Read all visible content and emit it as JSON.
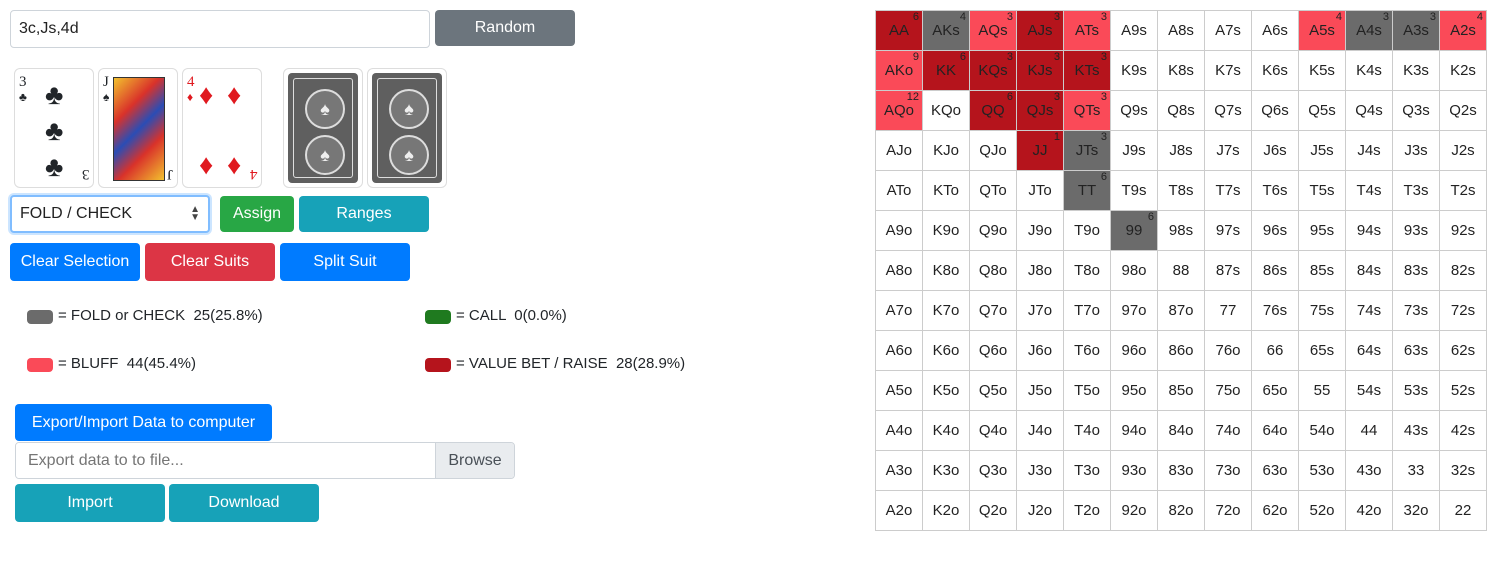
{
  "board_input": {
    "value": "3c,Js,4d"
  },
  "random_button": "Random",
  "cards": [
    {
      "rank": "3",
      "suit": "♣",
      "color": "#000000"
    },
    {
      "rank": "J",
      "suit": "♠",
      "color": "#000000"
    },
    {
      "rank": "4",
      "suit": "♦",
      "color": "#e0191f"
    }
  ],
  "card_back_icon": "spade-emblem",
  "action_select": {
    "value": "FOLD / CHECK"
  },
  "buttons": {
    "assign": "Assign",
    "ranges": "Ranges",
    "clear_selection": "Clear Selection",
    "clear_suits": "Clear Suits",
    "split_suit": "Split Suit",
    "export_import": "Export/Import Data to computer",
    "browse": "Browse",
    "import": "Import",
    "download": "Download"
  },
  "file_input": {
    "placeholder": "Export data to to file..."
  },
  "legend": {
    "fold": {
      "label": "= FOLD or CHECK",
      "stats": "25(25.8%)",
      "color": "#6b6b6b"
    },
    "call": {
      "label": "= CALL",
      "stats": "0(0.0%)",
      "color": "#1f7a1f"
    },
    "bluff": {
      "label": "= BLUFF",
      "stats": "44(45.4%)",
      "color": "#fa4a58"
    },
    "value": {
      "label": "= VALUE BET / RAISE",
      "stats": "28(28.9%)",
      "color": "#b5141c"
    }
  },
  "grid": [
    [
      [
        "AA",
        "value",
        "6"
      ],
      [
        "AKs",
        "fold",
        "4"
      ],
      [
        "AQs",
        "bluff",
        "3"
      ],
      [
        "AJs",
        "value",
        "3"
      ],
      [
        "ATs",
        "bluff",
        "3"
      ],
      [
        "A9s",
        "",
        ""
      ],
      [
        "A8s",
        "",
        ""
      ],
      [
        "A7s",
        "",
        ""
      ],
      [
        "A6s",
        "",
        ""
      ],
      [
        "A5s",
        "bluff",
        "4"
      ],
      [
        "A4s",
        "fold",
        "3"
      ],
      [
        "A3s",
        "fold",
        "3"
      ],
      [
        "A2s",
        "bluff",
        "4"
      ]
    ],
    [
      [
        "AKo",
        "bluff",
        "9"
      ],
      [
        "KK",
        "value",
        "6"
      ],
      [
        "KQs",
        "value",
        "3"
      ],
      [
        "KJs",
        "value",
        "3"
      ],
      [
        "KTs",
        "value",
        "3"
      ],
      [
        "K9s",
        "",
        ""
      ],
      [
        "K8s",
        "",
        ""
      ],
      [
        "K7s",
        "",
        ""
      ],
      [
        "K6s",
        "",
        ""
      ],
      [
        "K5s",
        "",
        ""
      ],
      [
        "K4s",
        "",
        ""
      ],
      [
        "K3s",
        "",
        ""
      ],
      [
        "K2s",
        "",
        ""
      ]
    ],
    [
      [
        "AQo",
        "bluff",
        "12"
      ],
      [
        "KQo",
        "",
        ""
      ],
      [
        "QQ",
        "value",
        "6"
      ],
      [
        "QJs",
        "value",
        "3"
      ],
      [
        "QTs",
        "bluff",
        "3"
      ],
      [
        "Q9s",
        "",
        ""
      ],
      [
        "Q8s",
        "",
        ""
      ],
      [
        "Q7s",
        "",
        ""
      ],
      [
        "Q6s",
        "",
        ""
      ],
      [
        "Q5s",
        "",
        ""
      ],
      [
        "Q4s",
        "",
        ""
      ],
      [
        "Q3s",
        "",
        ""
      ],
      [
        "Q2s",
        "",
        ""
      ]
    ],
    [
      [
        "AJo",
        "",
        ""
      ],
      [
        "KJo",
        "",
        ""
      ],
      [
        "QJo",
        "",
        ""
      ],
      [
        "JJ",
        "value",
        "1"
      ],
      [
        "JTs",
        "fold",
        "3"
      ],
      [
        "J9s",
        "",
        ""
      ],
      [
        "J8s",
        "",
        ""
      ],
      [
        "J7s",
        "",
        ""
      ],
      [
        "J6s",
        "",
        ""
      ],
      [
        "J5s",
        "",
        ""
      ],
      [
        "J4s",
        "",
        ""
      ],
      [
        "J3s",
        "",
        ""
      ],
      [
        "J2s",
        "",
        ""
      ]
    ],
    [
      [
        "ATo",
        "",
        ""
      ],
      [
        "KTo",
        "",
        ""
      ],
      [
        "QTo",
        "",
        ""
      ],
      [
        "JTo",
        "",
        ""
      ],
      [
        "TT",
        "fold",
        "6"
      ],
      [
        "T9s",
        "",
        ""
      ],
      [
        "T8s",
        "",
        ""
      ],
      [
        "T7s",
        "",
        ""
      ],
      [
        "T6s",
        "",
        ""
      ],
      [
        "T5s",
        "",
        ""
      ],
      [
        "T4s",
        "",
        ""
      ],
      [
        "T3s",
        "",
        ""
      ],
      [
        "T2s",
        "",
        ""
      ]
    ],
    [
      [
        "A9o",
        "",
        ""
      ],
      [
        "K9o",
        "",
        ""
      ],
      [
        "Q9o",
        "",
        ""
      ],
      [
        "J9o",
        "",
        ""
      ],
      [
        "T9o",
        "",
        ""
      ],
      [
        "99",
        "fold",
        "6"
      ],
      [
        "98s",
        "",
        ""
      ],
      [
        "97s",
        "",
        ""
      ],
      [
        "96s",
        "",
        ""
      ],
      [
        "95s",
        "",
        ""
      ],
      [
        "94s",
        "",
        ""
      ],
      [
        "93s",
        "",
        ""
      ],
      [
        "92s",
        "",
        ""
      ]
    ],
    [
      [
        "A8o",
        "",
        ""
      ],
      [
        "K8o",
        "",
        ""
      ],
      [
        "Q8o",
        "",
        ""
      ],
      [
        "J8o",
        "",
        ""
      ],
      [
        "T8o",
        "",
        ""
      ],
      [
        "98o",
        "",
        ""
      ],
      [
        "88",
        "",
        ""
      ],
      [
        "87s",
        "",
        ""
      ],
      [
        "86s",
        "",
        ""
      ],
      [
        "85s",
        "",
        ""
      ],
      [
        "84s",
        "",
        ""
      ],
      [
        "83s",
        "",
        ""
      ],
      [
        "82s",
        "",
        ""
      ]
    ],
    [
      [
        "A7o",
        "",
        ""
      ],
      [
        "K7o",
        "",
        ""
      ],
      [
        "Q7o",
        "",
        ""
      ],
      [
        "J7o",
        "",
        ""
      ],
      [
        "T7o",
        "",
        ""
      ],
      [
        "97o",
        "",
        ""
      ],
      [
        "87o",
        "",
        ""
      ],
      [
        "77",
        "",
        ""
      ],
      [
        "76s",
        "",
        ""
      ],
      [
        "75s",
        "",
        ""
      ],
      [
        "74s",
        "",
        ""
      ],
      [
        "73s",
        "",
        ""
      ],
      [
        "72s",
        "",
        ""
      ]
    ],
    [
      [
        "A6o",
        "",
        ""
      ],
      [
        "K6o",
        "",
        ""
      ],
      [
        "Q6o",
        "",
        ""
      ],
      [
        "J6o",
        "",
        ""
      ],
      [
        "T6o",
        "",
        ""
      ],
      [
        "96o",
        "",
        ""
      ],
      [
        "86o",
        "",
        ""
      ],
      [
        "76o",
        "",
        ""
      ],
      [
        "66",
        "",
        ""
      ],
      [
        "65s",
        "",
        ""
      ],
      [
        "64s",
        "",
        ""
      ],
      [
        "63s",
        "",
        ""
      ],
      [
        "62s",
        "",
        ""
      ]
    ],
    [
      [
        "A5o",
        "",
        ""
      ],
      [
        "K5o",
        "",
        ""
      ],
      [
        "Q5o",
        "",
        ""
      ],
      [
        "J5o",
        "",
        ""
      ],
      [
        "T5o",
        "",
        ""
      ],
      [
        "95o",
        "",
        ""
      ],
      [
        "85o",
        "",
        ""
      ],
      [
        "75o",
        "",
        ""
      ],
      [
        "65o",
        "",
        ""
      ],
      [
        "55",
        "",
        ""
      ],
      [
        "54s",
        "",
        ""
      ],
      [
        "53s",
        "",
        ""
      ],
      [
        "52s",
        "",
        ""
      ]
    ],
    [
      [
        "A4o",
        "",
        ""
      ],
      [
        "K4o",
        "",
        ""
      ],
      [
        "Q4o",
        "",
        ""
      ],
      [
        "J4o",
        "",
        ""
      ],
      [
        "T4o",
        "",
        ""
      ],
      [
        "94o",
        "",
        ""
      ],
      [
        "84o",
        "",
        ""
      ],
      [
        "74o",
        "",
        ""
      ],
      [
        "64o",
        "",
        ""
      ],
      [
        "54o",
        "",
        ""
      ],
      [
        "44",
        "",
        ""
      ],
      [
        "43s",
        "",
        ""
      ],
      [
        "42s",
        "",
        ""
      ]
    ],
    [
      [
        "A3o",
        "",
        ""
      ],
      [
        "K3o",
        "",
        ""
      ],
      [
        "Q3o",
        "",
        ""
      ],
      [
        "J3o",
        "",
        ""
      ],
      [
        "T3o",
        "",
        ""
      ],
      [
        "93o",
        "",
        ""
      ],
      [
        "83o",
        "",
        ""
      ],
      [
        "73o",
        "",
        ""
      ],
      [
        "63o",
        "",
        ""
      ],
      [
        "53o",
        "",
        ""
      ],
      [
        "43o",
        "",
        ""
      ],
      [
        "33",
        "",
        ""
      ],
      [
        "32s",
        "",
        ""
      ]
    ],
    [
      [
        "A2o",
        "",
        ""
      ],
      [
        "K2o",
        "",
        ""
      ],
      [
        "Q2o",
        "",
        ""
      ],
      [
        "J2o",
        "",
        ""
      ],
      [
        "T2o",
        "",
        ""
      ],
      [
        "92o",
        "",
        ""
      ],
      [
        "82o",
        "",
        ""
      ],
      [
        "72o",
        "",
        ""
      ],
      [
        "62o",
        "",
        ""
      ],
      [
        "52o",
        "",
        ""
      ],
      [
        "42o",
        "",
        ""
      ],
      [
        "32o",
        "",
        ""
      ],
      [
        "22",
        "",
        ""
      ]
    ]
  ]
}
